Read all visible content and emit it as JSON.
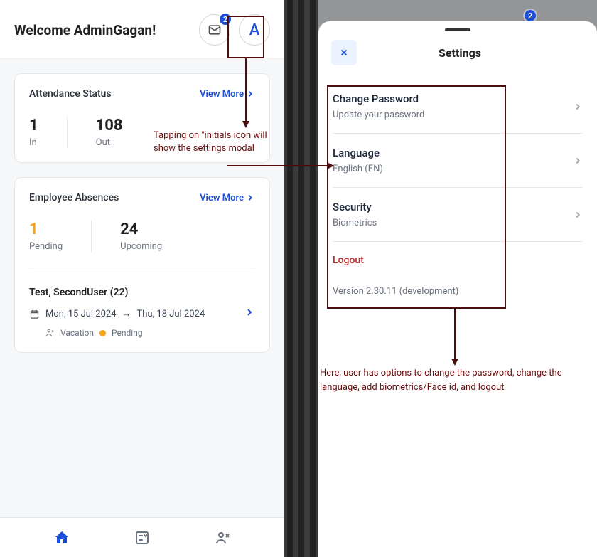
{
  "left": {
    "header": {
      "welcome": "Welcome AdminGagan!",
      "badge_count": "2",
      "avatar_initial": "A"
    },
    "attendance": {
      "title": "Attendance Status",
      "view_more": "View More",
      "in_value": "1",
      "in_label": "In",
      "out_value": "108",
      "out_label": "Out"
    },
    "absences": {
      "title": "Employee Absences",
      "view_more": "View More",
      "pending_value": "1",
      "pending_label": "Pending",
      "upcoming_value": "24",
      "upcoming_label": "Upcoming",
      "item": {
        "name": "Test, SecondUser (22)",
        "date_from": "Mon, 15 Jul 2024",
        "date_to": "Thu, 18 Jul 2024",
        "type": "Vacation",
        "status": "Pending"
      }
    },
    "annotation1": "Tapping on \"initials icon will show the settings modal"
  },
  "right": {
    "modal": {
      "title": "Settings",
      "badge_bg": "2",
      "items": [
        {
          "label": "Change Password",
          "sub": "Update your password"
        },
        {
          "label": "Language",
          "sub": "English (EN)"
        },
        {
          "label": "Security",
          "sub": "Biometrics"
        }
      ],
      "logout": "Logout",
      "version": "Version 2.30.11 (development)"
    },
    "annotation2": "Here, user has options to change the password, change the language, add biometrics/Face id, and logout"
  }
}
